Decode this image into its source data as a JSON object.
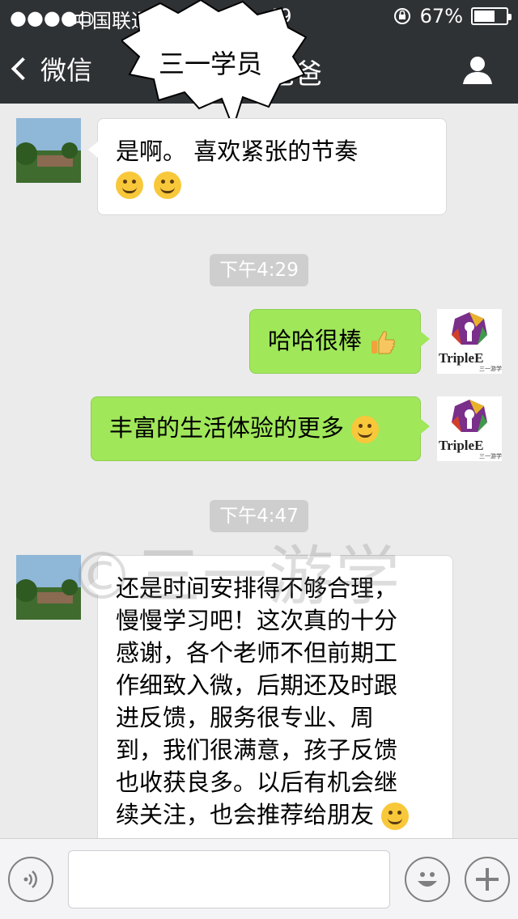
{
  "status_bar": {
    "signal": "●●●●○",
    "carrier": "中国联通",
    "time": "49",
    "battery_text": "67%",
    "battery_level": 0.67
  },
  "nav": {
    "back_label": "微信",
    "title": "爸爸"
  },
  "overlay": {
    "speech_text": "三一学员"
  },
  "messages": {
    "m1": {
      "text": "是啊。         喜欢紧张的节奏"
    },
    "t1": "下午4:29",
    "m2": {
      "text": "哈哈很棒"
    },
    "m3": {
      "text": "丰富的生活体验的更多"
    },
    "t2": "下午4:47",
    "m4": {
      "lines": [
        "还是时间安排得不够合理，",
        "慢慢学习吧！这次真的十分",
        "感谢，各个老师不但前期工",
        "作细致入微，后期还及时跟",
        "进反馈，服务很专业、周",
        "到，我们很满意，孩子反馈",
        "也收获良多。以后有机会继",
        "续关注，也会推荐给朋友"
      ]
    }
  },
  "brand_logo": {
    "text": "TripleE",
    "sub": "三一游学"
  },
  "watermark": "©三一游学",
  "colors": {
    "nav_bg": "#2f3235",
    "chat_bg": "#ebebeb",
    "sent_bubble": "#a0e75a",
    "received_bubble": "#ffffff"
  }
}
